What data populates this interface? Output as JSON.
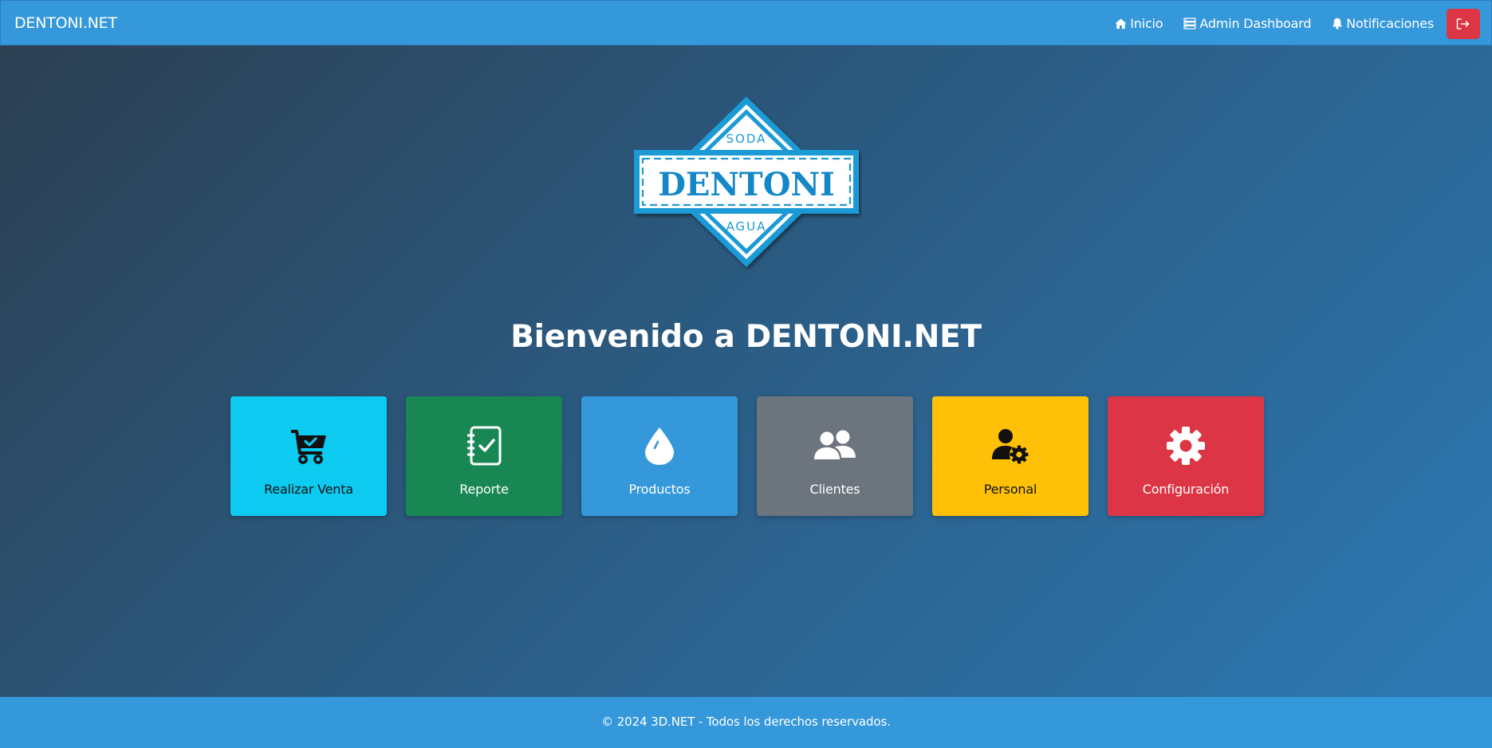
{
  "navbar": {
    "brand": "DENTONI.NET",
    "links": [
      {
        "label": "Inicio",
        "icon": "home-icon"
      },
      {
        "label": "Admin Dashboard",
        "icon": "server-icon"
      },
      {
        "label": "Notificaciones",
        "icon": "bell-icon"
      }
    ],
    "logout_icon": "logout-icon",
    "colors": {
      "bar": "#3498db",
      "logout": "#dc3545"
    }
  },
  "logo": {
    "top_text": "SODA",
    "main_text": "DENTONI",
    "bottom_text": "AGUA",
    "colors": {
      "primary": "#1a9ad6",
      "text": "#1488c7"
    }
  },
  "welcome": {
    "title": "Bienvenido a DENTONI.NET"
  },
  "tiles": [
    {
      "label": "Realizar Venta",
      "icon": "cart-check-icon",
      "color": "#0dcaf0"
    },
    {
      "label": "Reporte",
      "icon": "journal-check-icon",
      "color": "#198754"
    },
    {
      "label": "Productos",
      "icon": "droplet-icon",
      "color": "#3498db"
    },
    {
      "label": "Clientes",
      "icon": "people-icon",
      "color": "#6c757d"
    },
    {
      "label": "Personal",
      "icon": "person-gear-icon",
      "color": "#ffc107"
    },
    {
      "label": "Configuración",
      "icon": "gear-icon",
      "color": "#dc3545"
    }
  ],
  "footer": {
    "text": "© 2024 3D.NET - Todos los derechos reservados."
  }
}
